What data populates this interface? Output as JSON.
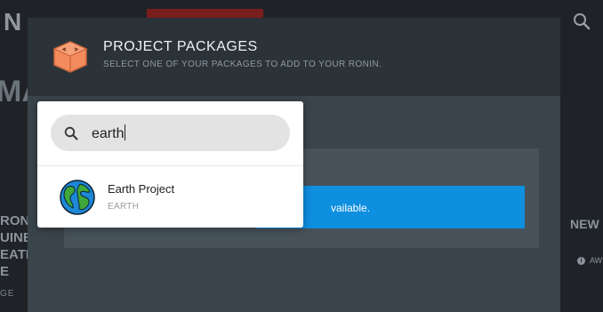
{
  "background": {
    "logo_fragment": "N",
    "heading_fragment": "MA",
    "side_lines": [
      "RONI",
      "UINE",
      "EATE",
      "E"
    ],
    "small_fragment": "GE",
    "right_heading_fragment": "NEW",
    "right_badge_text": "AW",
    "search_icon": "search-icon"
  },
  "modal": {
    "title": "PROJECT PACKAGES",
    "subtitle": "SELECT ONE OF YOUR PACKAGES TO ADD TO YOUR RONIN.",
    "icon": "package-box-icon",
    "banner_text": "vailable."
  },
  "search": {
    "value": "earth",
    "icon": "search-icon"
  },
  "results": [
    {
      "title": "Earth Project",
      "subtitle": "EARTH",
      "icon": "globe-icon"
    }
  ],
  "colors": {
    "banner_blue": "#0f8fe0",
    "modal_bg": "#3a444b",
    "header_bg": "#2b3338",
    "package_orange": "#f38b5c"
  }
}
